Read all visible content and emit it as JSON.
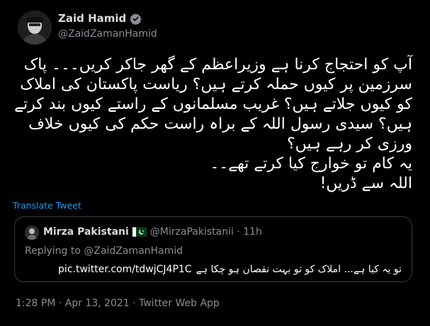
{
  "author": {
    "display_name": "Zaid Hamid",
    "handle": "@ZaidZamanHamid",
    "avatar_icon": "profile-photo",
    "verified_icon": "verified-badge-icon"
  },
  "tweet": {
    "text": "آپ کو احتجاج کرنا ہے وزیراعظم کے گھر جاکر کریں۔۔۔ پاک سرزمین پر کیوں حملہ کرتے ہیں؟ ریاست پاکستان کی املاک کو کیوں جلاتے ہیں؟ غریب مسلمانوں کے راستے کیوں بند کرتے ہیں؟ سیدی رسول اللہ کے براہ راست حکم کی کیوں خلاف ورزی کر رہے ہیں؟\nیہ کام تو خوارج کیا کرتے تھے۔۔\nاللہ سے ڈریں!",
    "translate_label": "Translate Tweet",
    "meta": "1:28 PM · Apr 13, 2021 · Twitter Web App"
  },
  "quote": {
    "display_name": "Mirza Pakistani",
    "flag_icon": "pakistan-flag-icon",
    "handle_time": "@MirzaPakistanii · 11h",
    "replying_prefix": "Replying to",
    "replying_to": "@ZaidZamanHamid",
    "text_urdu": "تو یہ کیا ہے... املاک کو تو بہت نقصان ہو چکا ہے",
    "link": "pic.twitter.com/tdwjCJ4P1C"
  },
  "colors": {
    "background": "#000000",
    "link": "#1d9bf0",
    "secondary_text": "#8a8d91",
    "verified": "#8a8d91"
  }
}
